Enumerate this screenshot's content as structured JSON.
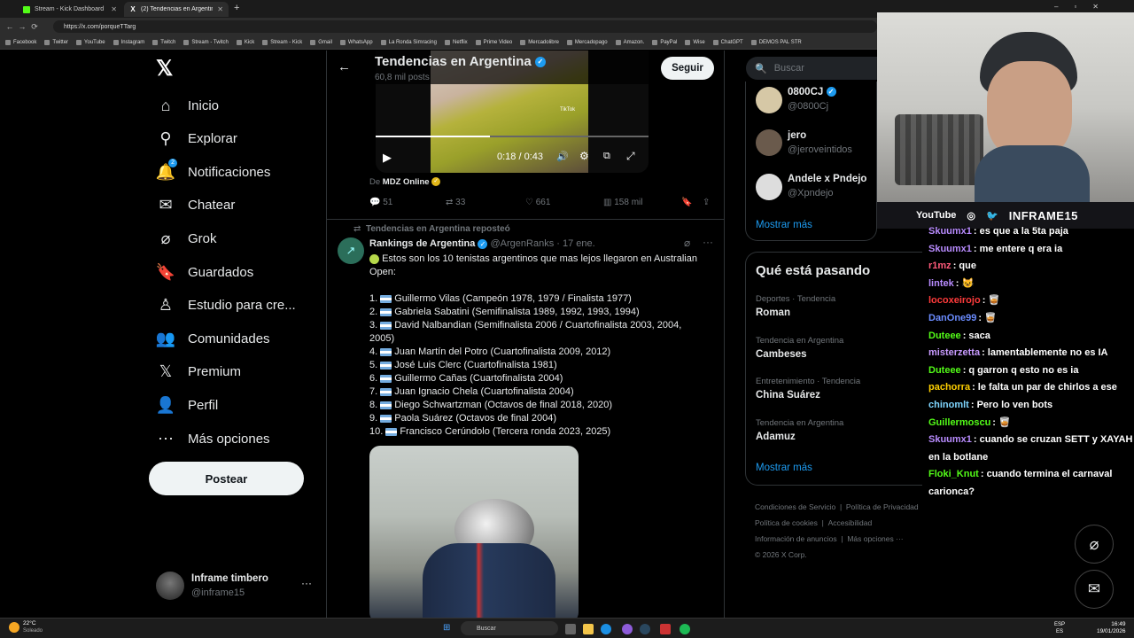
{
  "browser": {
    "tabs": [
      {
        "title": "Stream - Kick Dashboard",
        "active": false
      },
      {
        "title": "(2) Tendencias en Argentina (@porq",
        "active": true
      }
    ],
    "url": "https://x.com/porqueTTarg",
    "bookmarks": [
      "Facebook",
      "Twitter",
      "YouTube",
      "Instagram",
      "Twitch",
      "Stream - Twitch",
      "Kick",
      "Stream - Kick",
      "Gmail",
      "WhatsApp",
      "La Ronda Simracing",
      "Netflix",
      "Prime Video",
      "Mercadolibre",
      "Mercadopago",
      "Amazon.",
      "PayPal",
      "Wise",
      "ChatGPT",
      "DEMOS PAL STR"
    ]
  },
  "sidebar": {
    "items": [
      {
        "label": "Inicio",
        "icon": "home-icon"
      },
      {
        "label": "Explorar",
        "icon": "search-icon"
      },
      {
        "label": "Notificaciones",
        "icon": "bell-icon",
        "badge": "2"
      },
      {
        "label": "Chatear",
        "icon": "mail-icon"
      },
      {
        "label": "Grok",
        "icon": "grok-icon"
      },
      {
        "label": "Guardados",
        "icon": "bookmark-icon"
      },
      {
        "label": "Estudio para cre...",
        "icon": "studio-icon"
      },
      {
        "label": "Comunidades",
        "icon": "people-icon"
      },
      {
        "label": "Premium",
        "icon": "x-icon"
      },
      {
        "label": "Perfil",
        "icon": "person-icon"
      },
      {
        "label": "Más opciones",
        "icon": "more-circle-icon"
      }
    ],
    "post_label": "Postear",
    "profile": {
      "name": "Inframe timbero",
      "handle": "@inframe15",
      "more": "···"
    }
  },
  "header": {
    "title": "Tendencias en Argentina",
    "subtitle": "60,8 mil posts",
    "follow_label": "Seguir"
  },
  "video": {
    "time": "0:18 / 0:43",
    "tiktok_label": "TikTok",
    "progress": 0.42
  },
  "tweet1": {
    "source_prefix": "De",
    "source": "MDZ Online",
    "replies": "51",
    "reposts": "33",
    "likes": "661",
    "views": "158 mil"
  },
  "tweet2": {
    "repost_note": "Tendencias en Argentina reposteó",
    "author": "Rankings de Argentina",
    "handle": "@ArgenRanks",
    "date": "· 17 ene.",
    "intro": "Estos son los 10 tenistas argentinos que mas lejos llegaron en Australian Open:",
    "list": [
      "1. Guillermo Vilas (Campeón 1978, 1979 / Finalista 1977)",
      "2. Gabriela Sabatini (Semifinalista 1989, 1992, 1993, 1994)",
      "3. David Nalbandian (Semifinalista 2006 / Cuartofinalista 2003, 2004,",
      "4. Juan Martín del Potro (Cuartofinalista 2009, 2012)",
      "5. José Luis Clerc (Cuartofinalista 1981)",
      "6. Guillermo Cañas (Cuartofinalista 2004)",
      "7. Juan Ignacio Chela (Cuartofinalista 2004)",
      "8. Diego Schwartzman (Octavos de final 2018, 2020)",
      "9. Paola Suárez (Octavos de final 2004)",
      "10. Francisco Cerúndolo (Tercera ronda 2023, 2025)"
    ],
    "list_cont": "2005)"
  },
  "right": {
    "search_placeholder": "Buscar",
    "follow_suggestions": [
      {
        "name": "0800CJ",
        "handle": "@0800Cj",
        "verified": true
      },
      {
        "name": "jero",
        "handle": "@jeroveintidos",
        "verified": false
      },
      {
        "name": "Andele x Pndejo",
        "handle": "@Xpndejo",
        "verified": false
      }
    ],
    "show_more": "Mostrar más",
    "trends_title": "Qué está pasando",
    "trends": [
      {
        "category": "Deportes · Tendencia",
        "name": "Roman"
      },
      {
        "category": "Tendencia en Argentina",
        "name": "Cambeses"
      },
      {
        "category": "Entretenimiento · Tendencia",
        "name": "China Suárez"
      },
      {
        "category": "Tendencia en Argentina",
        "name": "Adamuz"
      }
    ],
    "trends_more": "Mostrar más",
    "footer": [
      "Condiciones de Servicio",
      "|",
      "Política de Privacidad",
      "Política de cookies",
      "|",
      "Accesibilidad",
      "Información de anuncios",
      "|",
      "Más opciones ···",
      "© 2026 X Corp."
    ]
  },
  "stream": {
    "socials": [
      "YouTube",
      "INFRAME15"
    ],
    "chat": [
      {
        "user": "Skuumx1",
        "text": ": es que a la 5ta paja",
        "color": "#b98cff"
      },
      {
        "user": "Skuumx1",
        "text": ": me entere q era ia",
        "color": "#b98cff"
      },
      {
        "user": "r1mz",
        "text": ": que",
        "color": "#ff5a7a"
      },
      {
        "user": "lintek",
        "text": ": 😺",
        "color": "#b98cff"
      },
      {
        "user": "locoxeirojo",
        "text": ": 🥃",
        "color": "#ff3b3b"
      },
      {
        "user": "DanOne99",
        "text": ": 🥃",
        "color": "#6b8cff"
      },
      {
        "user": "Duteee",
        "text": ": saca",
        "color": "#53fc18"
      },
      {
        "user": "misterzetta",
        "text": ": lamentablemente no es IA",
        "color": "#c89bff"
      },
      {
        "user": "Duteee",
        "text": ": q garron q esto no es ia",
        "color": "#53fc18"
      },
      {
        "user": "pachorra",
        "text": ": le falta un par de chirlos a ese",
        "color": "#ffd000"
      },
      {
        "user": "chinomlt",
        "text": ": Pero lo ven bots",
        "color": "#7fd6ff"
      },
      {
        "user": "Guillermoscu",
        "text": ": 🥃",
        "color": "#53fc18"
      },
      {
        "user": "Skuumx1",
        "text": ": cuando se cruzan SETT y XAYAH en la botlane",
        "color": "#b98cff"
      },
      {
        "user": "Floki_Knut",
        "text": ": cuando termina el carnaval carionca?",
        "color": "#53fc18"
      }
    ]
  },
  "taskbar": {
    "weather_temp": "22°C",
    "weather_desc": "Soleado",
    "search": "Buscar",
    "lang1": "ESP",
    "lang2": "ES",
    "time": "16:49",
    "date": "19/01/2026"
  }
}
